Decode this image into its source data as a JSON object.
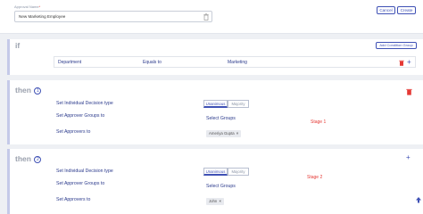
{
  "header": {
    "approval_name_label": "Approval Name",
    "required_mark": "*",
    "approval_name_value": "New Marketing Employee",
    "cancel_label": "Cancel",
    "create_label": "Create"
  },
  "if_section": {
    "keyword": "if",
    "add_condition_group_label": "Add Condition Group",
    "condition": {
      "field": "Department",
      "operator": "Equals to",
      "value": "Marketing"
    }
  },
  "stages": [
    {
      "keyword": "then",
      "number": "1",
      "decision_type_label": "Set Individual Decision type",
      "option_unanimous": "Unanimous",
      "option_majority": "Majority",
      "selected": "Unanimous",
      "approver_groups_label": "Set Approver Groups to",
      "select_groups_text": "Select Groups",
      "stage_label": "Stage 1",
      "approvers_label": "Set Approvers to",
      "approver_chip": "Ameriya Gupta",
      "chip_remove": "×"
    },
    {
      "keyword": "then",
      "number": "2",
      "decision_type_label": "Set Individual Decision type",
      "option_unanimous": "Unanimous",
      "option_majority": "Majority",
      "selected": "Unanimous",
      "approver_groups_label": "Set Approver Groups to",
      "select_groups_text": "Select Groups",
      "stage_label": "Stage 2",
      "approvers_label": "Set Approvers to",
      "approver_chip": "John",
      "chip_remove": "×"
    }
  ],
  "icons": {
    "plus": "+",
    "scroll_up": "🡡"
  },
  "colors": {
    "accent": "#3f51b5",
    "danger": "#e53935",
    "panel_border": "#c5cae9"
  }
}
